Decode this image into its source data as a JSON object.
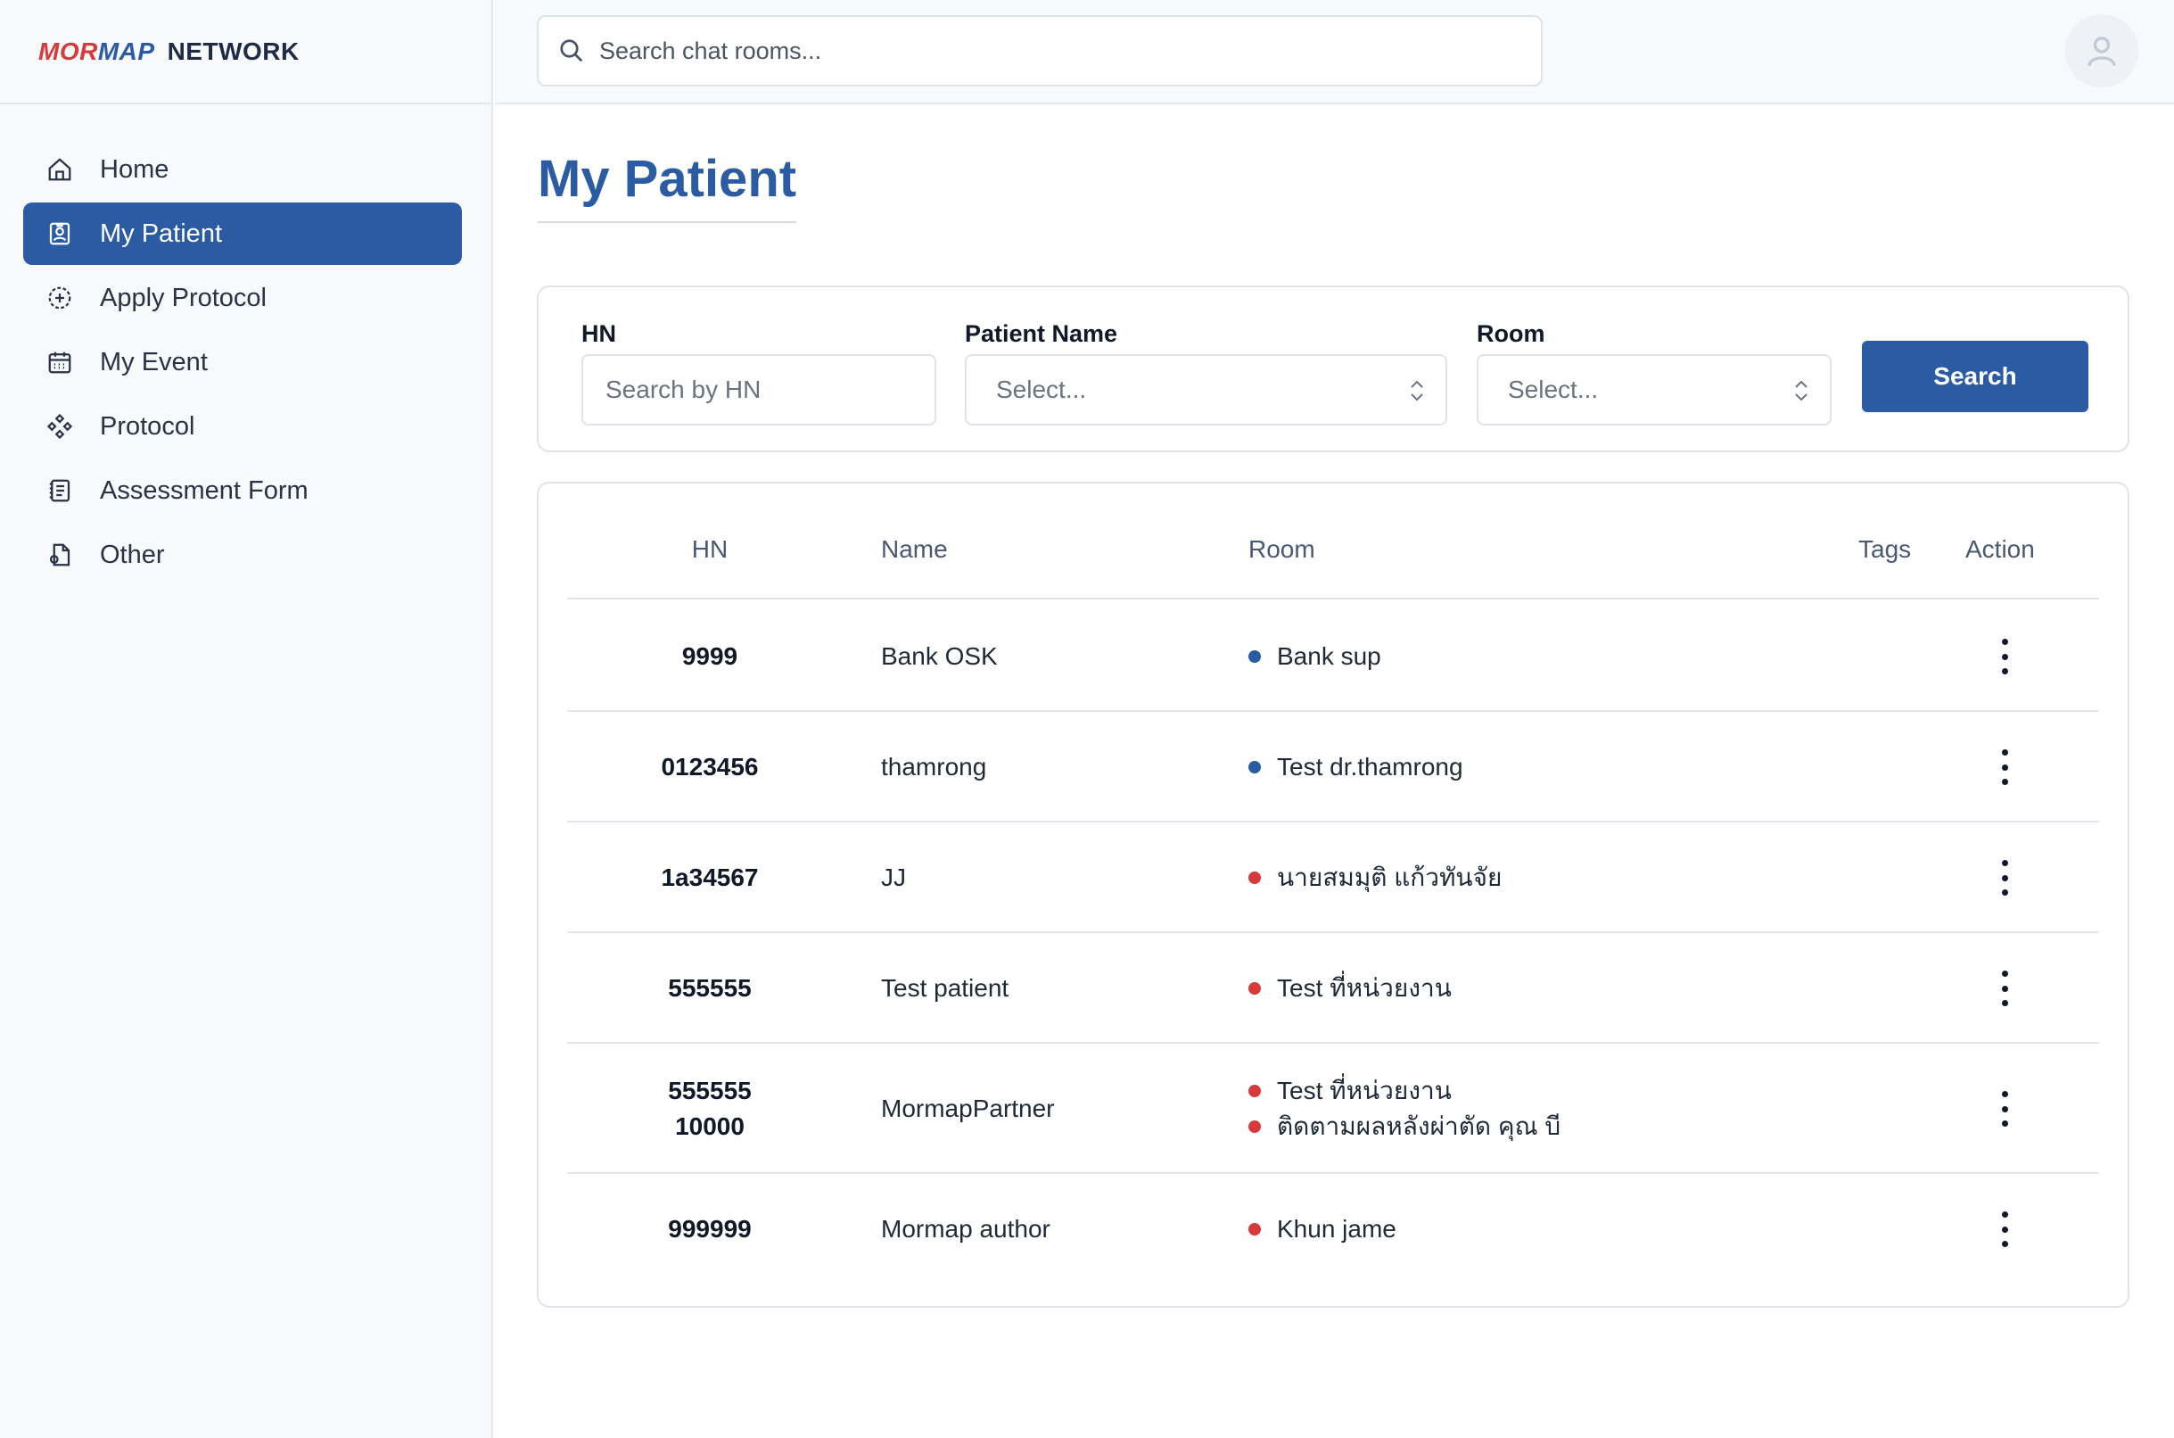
{
  "brand": {
    "part1": "MOR",
    "part2": "MAP",
    "part3": "NETWORK"
  },
  "sidebar": {
    "items": [
      {
        "label": "Home",
        "icon": "home-icon",
        "active": false
      },
      {
        "label": "My Patient",
        "icon": "patient-badge-icon",
        "active": true
      },
      {
        "label": "Apply Protocol",
        "icon": "apply-plus-icon",
        "active": false
      },
      {
        "label": "My Event",
        "icon": "calendar-icon",
        "active": false
      },
      {
        "label": "Protocol",
        "icon": "protocol-grid-icon",
        "active": false
      },
      {
        "label": "Assessment Form",
        "icon": "form-list-icon",
        "active": false
      },
      {
        "label": "Other",
        "icon": "document-icon",
        "active": false
      }
    ]
  },
  "topbar": {
    "search_placeholder": "Search chat rooms...",
    "avatar_icon": "user-icon"
  },
  "page": {
    "title": "My Patient"
  },
  "filters": {
    "hn_label": "HN",
    "hn_placeholder": "Search by HN",
    "name_label": "Patient Name",
    "name_placeholder": "Select...",
    "room_label": "Room",
    "room_placeholder": "Select...",
    "search_button": "Search"
  },
  "table": {
    "headers": {
      "hn": "HN",
      "name": "Name",
      "room": "Room",
      "tags": "Tags",
      "action": "Action"
    },
    "rows": [
      {
        "hn": [
          "9999"
        ],
        "name": "Bank OSK",
        "rooms": [
          {
            "text": "Bank sup",
            "color": "#2a5ba3"
          }
        ]
      },
      {
        "hn": [
          "0123456"
        ],
        "name": "thamrong",
        "rooms": [
          {
            "text": "Test dr.thamrong",
            "color": "#2a5ba3"
          }
        ]
      },
      {
        "hn": [
          "1a34567"
        ],
        "name": "JJ",
        "rooms": [
          {
            "text": "นายสมมุติ แก้วทันจัย",
            "color": "#d63a3a"
          }
        ]
      },
      {
        "hn": [
          "555555"
        ],
        "name": "Test patient",
        "rooms": [
          {
            "text": "Test ที่หน่วยงาน",
            "color": "#d63a3a"
          }
        ]
      },
      {
        "hn": [
          "555555",
          "10000"
        ],
        "name": "MormapPartner",
        "rooms": [
          {
            "text": "Test ที่หน่วยงาน",
            "color": "#d63a3a"
          },
          {
            "text": "ติดตามผลหลังผ่าตัด คุณ บี",
            "color": "#d63a3a"
          }
        ]
      },
      {
        "hn": [
          "999999"
        ],
        "name": "Mormap author",
        "rooms": [
          {
            "text": "Khun jame",
            "color": "#d63a3a"
          }
        ]
      }
    ]
  },
  "colors": {
    "primary": "#2a5ba3",
    "accent_red": "#d63a3a",
    "border": "#dfe3ea"
  }
}
